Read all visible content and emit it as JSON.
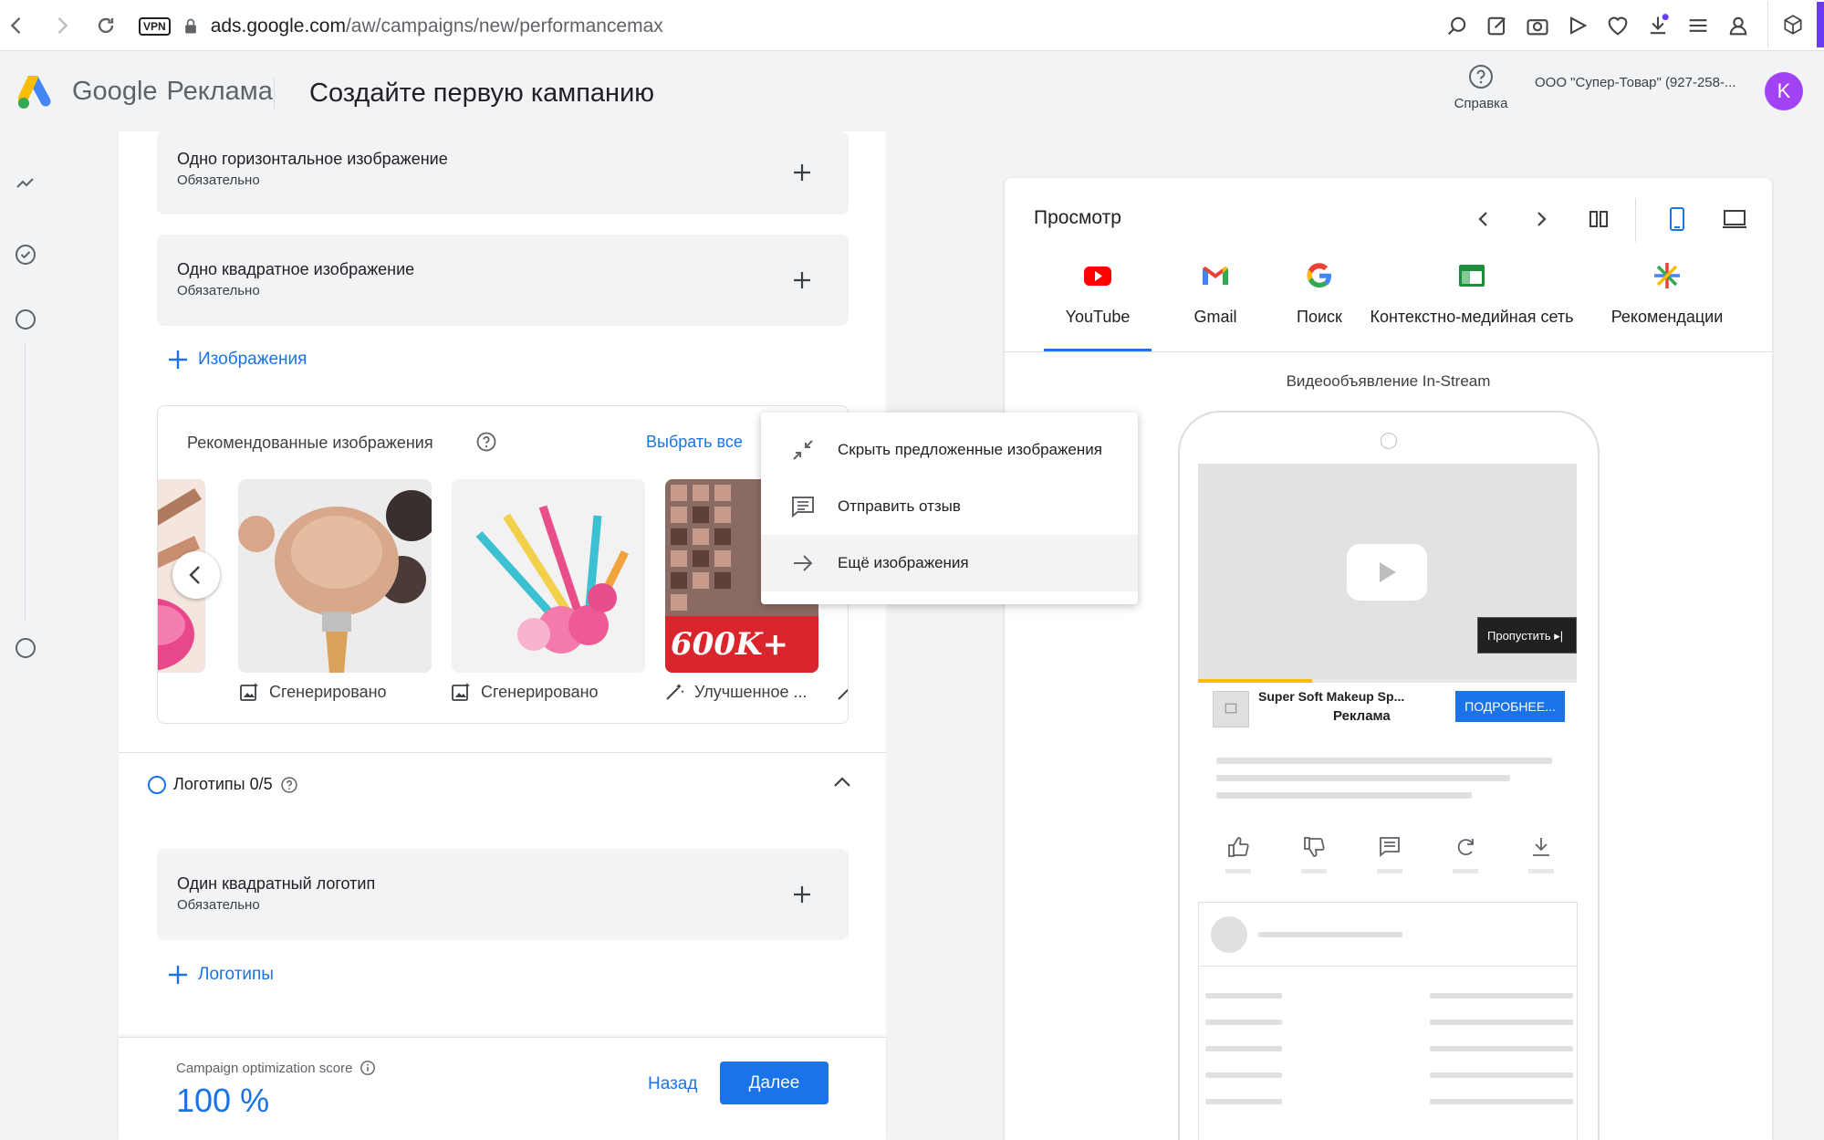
{
  "browser": {
    "vpn_label": "VPN",
    "url_host": "ads.google.com",
    "url_path": "/aw/campaigns/new/performancemax"
  },
  "header": {
    "brand_google": "Google",
    "brand_product": "Реклама",
    "page_title": "Создайте первую кампанию",
    "help_label": "Справка",
    "account_name": "ООО \"Супер-Товар\" (927-258-...",
    "avatar_letter": "K"
  },
  "assets": {
    "horizontal_image": {
      "title": "Одно горизонтальное изображение",
      "subtitle": "Обязательно"
    },
    "square_image": {
      "title": "Одно квадратное изображение",
      "subtitle": "Обязательно"
    },
    "add_images_label": "Изображения",
    "recommended": {
      "title": "Рекомендованные изображения",
      "select_all": "Выбрать все",
      "thumbnails": [
        {
          "label": "Сгенерировано",
          "badge": "generated-icon"
        },
        {
          "label": "Сгенерировано",
          "badge": "generated-icon"
        },
        {
          "label": "Улучшенное ...",
          "badge": "magic-wand-icon",
          "overlay_text": "600K+"
        }
      ]
    },
    "logos": {
      "header": "Логотипы 0/5",
      "square_logo": {
        "title": "Один квадратный логотип",
        "subtitle": "Обязательно"
      },
      "add_logos_label": "Логотипы"
    }
  },
  "context_menu": {
    "items": [
      {
        "label": "Скрыть предложенные изображения",
        "icon": "collapse-icon"
      },
      {
        "label": "Отправить отзыв",
        "icon": "feedback-icon"
      },
      {
        "label": "Ещё изображения",
        "icon": "arrow-right-icon"
      }
    ]
  },
  "footer": {
    "score_label": "Campaign optimization score",
    "score_value": "100 %",
    "back_label": "Назад",
    "next_label": "Далее"
  },
  "preview": {
    "title": "Просмотр",
    "channels": [
      {
        "label": "YouTube",
        "selected": true
      },
      {
        "label": "Gmail",
        "selected": false
      },
      {
        "label": "Поиск",
        "selected": false
      },
      {
        "label": "Контекстно-медийная сеть",
        "selected": false
      },
      {
        "label": "Рекомендации",
        "selected": false
      }
    ],
    "format_label": "Видеообъявление In-Stream",
    "video": {
      "skip_label": "Пропустить",
      "progress": 0.3
    },
    "ad": {
      "headline": "Super Soft Makeup Sp...",
      "label": "Реклама",
      "cta": "ПОДРОБНЕЕ..."
    },
    "selected_device": "mobile"
  },
  "colors": {
    "accent": "#1a73e8",
    "avatar": "#a142f4",
    "youtube": "#ff0000"
  }
}
